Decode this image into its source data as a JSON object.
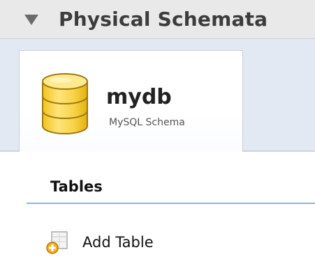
{
  "section": {
    "title": "Physical Schemata",
    "expanded": true,
    "arrow_icon": "triangle-down-icon"
  },
  "schema_tab": {
    "icon": "database-icon",
    "name": "mydb",
    "type": "MySQL Schema"
  },
  "tables": {
    "heading": "Tables",
    "add_label": "Add Table",
    "add_icon": "add-table-icon"
  },
  "colors": {
    "header_bg": "#e9e9e9",
    "tab_strip_bg": "#e2e9f3",
    "underline": "#8db3e6",
    "db_icon": "#f5cc3a"
  }
}
